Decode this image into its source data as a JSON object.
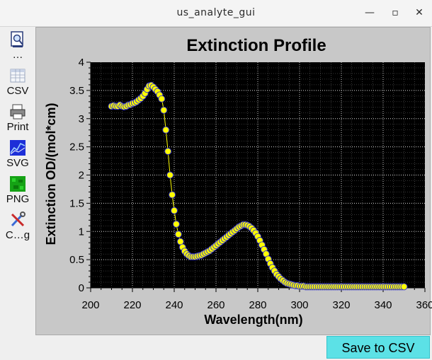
{
  "window": {
    "title": "us_analyte_gui",
    "controls": {
      "minimize": "—",
      "maximize": "▫",
      "close": "✕"
    }
  },
  "toolbar": {
    "items": [
      {
        "label": "…",
        "icon": "zoom-page-icon"
      },
      {
        "label": "CSV",
        "icon": "spreadsheet-icon"
      },
      {
        "label": "Print",
        "icon": "printer-icon"
      },
      {
        "label": "SVG",
        "icon": "svg-image-icon"
      },
      {
        "label": "PNG",
        "icon": "png-image-icon"
      },
      {
        "label": "C…g",
        "icon": "tools-icon"
      }
    ]
  },
  "actions": {
    "save_csv": "Save to CSV"
  },
  "colors": {
    "plot_background": "#000000",
    "frame": "#c8c8c8",
    "curve": "#ffff00",
    "button": "#5ce1e6"
  },
  "chart_data": {
    "type": "scatter",
    "title": "Extinction Profile",
    "xlabel": "Wavelength(nm)",
    "ylabel": "Extinction OD/(mol*cm)",
    "xlim": [
      200,
      360
    ],
    "ylim": [
      0,
      4
    ],
    "xticks": [
      "200",
      "220",
      "240",
      "260",
      "280",
      "300",
      "320",
      "340",
      "360"
    ],
    "yticks": [
      "0",
      "0.5",
      "1",
      "1.5",
      "2",
      "2.5",
      "3",
      "3.5",
      "4"
    ],
    "grid": true,
    "series": [
      {
        "x": [
          210,
          211,
          212,
          213,
          214,
          215,
          216,
          217,
          218,
          219,
          220,
          221,
          222,
          223,
          224,
          225,
          226,
          227,
          228,
          229,
          230,
          231,
          232,
          233,
          234,
          235,
          236,
          237,
          238,
          239,
          240,
          241,
          242,
          243,
          244,
          245,
          246,
          247,
          248,
          249,
          250,
          251,
          252,
          253,
          254,
          255,
          256,
          257,
          258,
          259,
          260,
          261,
          262,
          263,
          264,
          265,
          266,
          267,
          268,
          269,
          270,
          271,
          272,
          273,
          274,
          275,
          276,
          277,
          278,
          279,
          280,
          281,
          282,
          283,
          284,
          285,
          286,
          287,
          288,
          289,
          290,
          291,
          292,
          293,
          294,
          295,
          296,
          297,
          298,
          299,
          300,
          301,
          302,
          303,
          304,
          305,
          306,
          307,
          308,
          309,
          310,
          311,
          312,
          313,
          314,
          315,
          316,
          317,
          318,
          319,
          320,
          321,
          322,
          323,
          324,
          325,
          326,
          327,
          328,
          329,
          330,
          331,
          332,
          333,
          334,
          335,
          336,
          337,
          338,
          339,
          340,
          341,
          342,
          343,
          344,
          345,
          346,
          347,
          348,
          349,
          350
        ],
        "y": [
          3.22,
          3.23,
          3.22,
          3.22,
          3.24,
          3.22,
          3.21,
          3.22,
          3.24,
          3.25,
          3.27,
          3.28,
          3.3,
          3.33,
          3.36,
          3.4,
          3.45,
          3.52,
          3.58,
          3.59,
          3.56,
          3.52,
          3.48,
          3.42,
          3.35,
          3.15,
          2.8,
          2.42,
          2.0,
          1.65,
          1.37,
          1.13,
          0.95,
          0.82,
          0.72,
          0.65,
          0.6,
          0.57,
          0.55,
          0.55,
          0.55,
          0.56,
          0.57,
          0.58,
          0.6,
          0.62,
          0.64,
          0.66,
          0.69,
          0.72,
          0.75,
          0.78,
          0.81,
          0.84,
          0.87,
          0.9,
          0.93,
          0.96,
          0.99,
          1.02,
          1.05,
          1.08,
          1.1,
          1.12,
          1.12,
          1.11,
          1.09,
          1.06,
          1.02,
          0.97,
          0.91,
          0.84,
          0.76,
          0.68,
          0.6,
          0.51,
          0.43,
          0.36,
          0.3,
          0.24,
          0.2,
          0.16,
          0.13,
          0.1,
          0.08,
          0.07,
          0.06,
          0.05,
          0.04,
          0.04,
          0.03,
          0.03,
          0.03,
          0.02,
          0.02,
          0.02,
          0.02,
          0.02,
          0.02,
          0.02,
          0.02,
          0.02,
          0.02,
          0.02,
          0.02,
          0.02,
          0.02,
          0.02,
          0.02,
          0.02,
          0.02,
          0.02,
          0.02,
          0.02,
          0.02,
          0.02,
          0.02,
          0.02,
          0.02,
          0.02,
          0.02,
          0.02,
          0.02,
          0.02,
          0.02,
          0.02,
          0.02,
          0.02,
          0.02,
          0.02,
          0.02,
          0.02,
          0.02,
          0.02,
          0.02,
          0.02,
          0.02,
          0.02,
          0.02,
          0.02,
          0.02
        ]
      }
    ]
  }
}
